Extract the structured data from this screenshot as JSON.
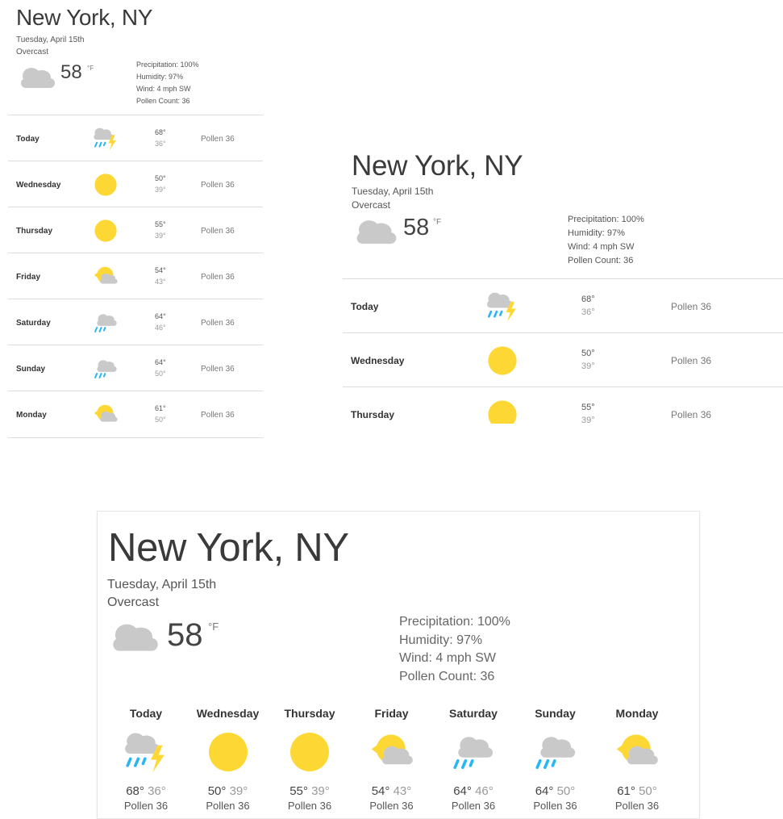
{
  "location": "New York, NY",
  "date": "Tuesday, April 15th",
  "condition": "Overcast",
  "current_temp": "58",
  "unit": "°F",
  "details": {
    "precipitation": "Precipitation: 100%",
    "humidity": "Humidity: 97%",
    "wind": "Wind: 4 mph SW",
    "pollen": "Pollen Count: 36"
  },
  "current_icon": "cloud-icon",
  "forecast": [
    {
      "day": "Today",
      "high": "68°",
      "low": "36°",
      "pollen": "Pollen 36",
      "icon": "thunderstorm-icon"
    },
    {
      "day": "Wednesday",
      "high": "50°",
      "low": "39°",
      "pollen": "Pollen 36",
      "icon": "sun-icon"
    },
    {
      "day": "Thursday",
      "high": "55°",
      "low": "39°",
      "pollen": "Pollen 36",
      "icon": "sun-icon"
    },
    {
      "day": "Friday",
      "high": "54°",
      "low": "43°",
      "pollen": "Pollen 36",
      "icon": "partly-cloudy-icon"
    },
    {
      "day": "Saturday",
      "high": "64°",
      "low": "46°",
      "pollen": "Pollen 36",
      "icon": "rain-cloud-icon"
    },
    {
      "day": "Sunday",
      "high": "64°",
      "low": "50°",
      "pollen": "Pollen 36",
      "icon": "rain-cloud-icon"
    },
    {
      "day": "Monday",
      "high": "61°",
      "low": "50°",
      "pollen": "Pollen 36",
      "icon": "partly-cloudy-icon"
    }
  ],
  "colors": {
    "sun": "#FDD835",
    "cloud": "#C9C9C9",
    "rain": "#29B6F6",
    "divider": "#DCDCDC"
  }
}
